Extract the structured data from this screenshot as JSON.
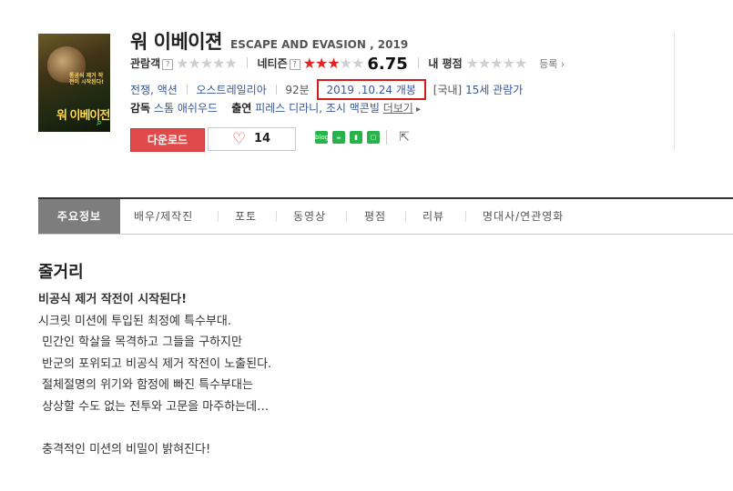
{
  "movie": {
    "title_ko": "워 이베이젼",
    "title_en": "ESCAPE AND EVASION , 2019",
    "poster": {
      "title_text": "워 이베이전",
      "tagline": "통공식 제거 작전이 시작된다!"
    }
  },
  "ratings": {
    "audience_label": "관람객",
    "netizen_label": "네티즌",
    "netizen_score": "6.75",
    "netizen_fraction": 0.675,
    "my_rating_label": "내 평점",
    "register_label": "등록",
    "help_icon": "?",
    "stars_glyph": "★★★★★"
  },
  "info": {
    "genres": "전쟁, 액션",
    "country": "오스트레일리아",
    "runtime": "92분",
    "release": "2019 .10.24 개봉",
    "rating_bracket": "[국내]",
    "age_rating": "15세 관람가"
  },
  "crew": {
    "director_label": "감독",
    "director": "스톰 애쉬우드",
    "cast_label": "출연",
    "cast": "피레스 디라니, 조시 맥콘빌",
    "more": "더보기"
  },
  "actions": {
    "download": "다운로드",
    "like_count": "14",
    "social_blog": "blog"
  },
  "tabs": [
    "주요정보",
    "배우/제작진",
    "포토",
    "동영상",
    "평점",
    "리뷰",
    "명대사/연관영화"
  ],
  "synopsis": {
    "heading": "줄거리",
    "headline": "비공식 제거 작전이 시작된다!",
    "lines": [
      "시크릿 미션에 투입된 최정예 특수부대.",
      " 민간인 학살을 목격하고 그들을 구하지만",
      " 반군의 포위되고 비공식 제거 작전이 노출된다.",
      " 절체절명의 위기와 함정에 빠진 특수부대는",
      " 상상할 수도 없는 전투와 고문을 마주하는데…",
      "",
      " 충격적인 미션의 비밀이 밝혀진다!"
    ]
  },
  "colors": {
    "accent": "#e14a4a",
    "link": "#3b5998",
    "highlight_box": "#d61a1a",
    "star_red": "#e02424"
  }
}
